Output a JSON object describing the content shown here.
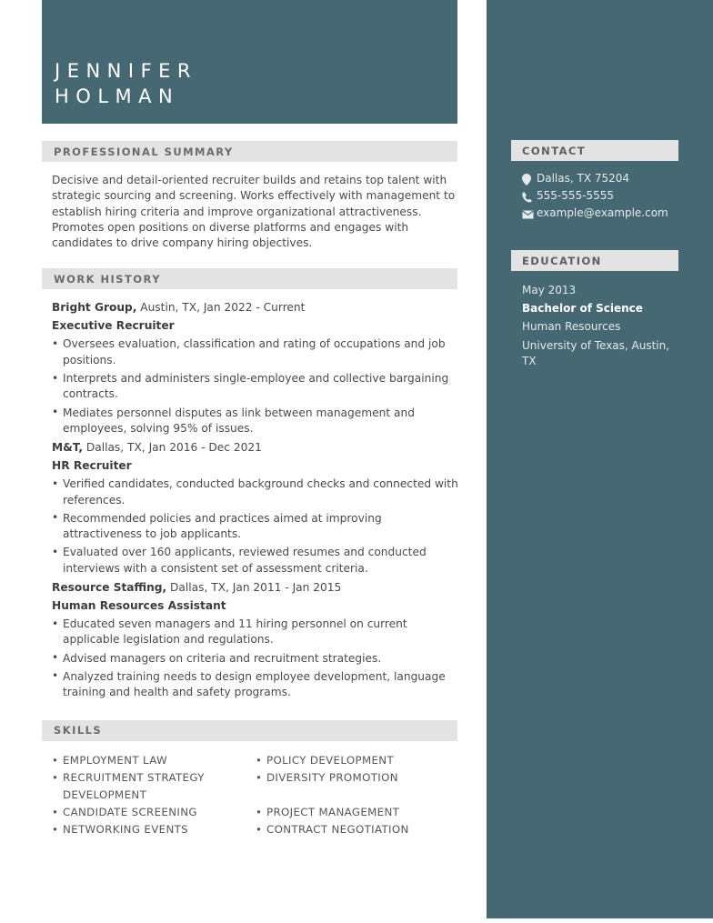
{
  "theme": {
    "accent": "#456872",
    "section_bar": "#e3e3e3",
    "body_text": "#4a4a4a",
    "sidebar_text": "#e6eaeb"
  },
  "header": {
    "first_name": "JENNIFER",
    "last_name": "HOLMAN"
  },
  "sections": {
    "summary_heading": "PROFESSIONAL SUMMARY",
    "work_heading": "WORK HISTORY",
    "skills_heading": "SKILLS",
    "contact_heading": "CONTACT",
    "education_heading": "EDUCATION"
  },
  "summary": {
    "text": "Decisive and detail-oriented recruiter builds and retains top talent with strategic sourcing and screening. Works effectively with management to establish hiring criteria and improve organizational attractiveness. Promotes open positions on diverse platforms and engages with candidates to drive company hiring objectives."
  },
  "work_history": [
    {
      "company": "Bright Group,",
      "meta": " Austin, TX, Jan 2022 - Current",
      "title": "Executive Recruiter",
      "bullets": [
        "Oversees evaluation, classification and rating of occupations and job positions.",
        "Interprets and administers single-employee and collective bargaining contracts.",
        "Mediates personnel disputes as link between management and employees, solving 95% of issues."
      ]
    },
    {
      "company": "M&T,",
      "meta": " Dallas, TX, Jan 2016 - Dec 2021",
      "title": "HR Recruiter",
      "bullets": [
        "Verified candidates, conducted background checks and connected with references.",
        "Recommended policies and practices aimed at improving attractiveness to job applicants.",
        "Evaluated over 160 applicants, reviewed resumes and conducted interviews with a consistent set of assessment criteria."
      ]
    },
    {
      "company": "Resource Staffing,",
      "meta": " Dallas, TX, Jan 2011 - Jan 2015",
      "title": "Human Resources Assistant",
      "bullets": [
        "Educated seven managers and 11 hiring personnel on current applicable legislation and regulations.",
        "Advised managers on criteria and recruitment strategies.",
        "Analyzed training needs to design employee development, language training and health and safety programs."
      ]
    }
  ],
  "skills": {
    "left_column": [
      "EMPLOYMENT LAW",
      "RECRUITMENT STRATEGY DEVELOPMENT",
      "CANDIDATE SCREENING",
      "NETWORKING EVENTS"
    ],
    "right_column": [
      "POLICY DEVELOPMENT",
      "DIVERSITY PROMOTION",
      "PROJECT MANAGEMENT",
      "CONTRACT NEGOTIATION"
    ]
  },
  "contact": {
    "items": [
      {
        "icon": "location-pin-icon",
        "text": "Dallas, TX 75204"
      },
      {
        "icon": "phone-icon",
        "text": "555-555-5555"
      },
      {
        "icon": "envelope-icon",
        "text": "example@example.com"
      }
    ]
  },
  "education": {
    "date": "May 2013",
    "degree": "Bachelor of Science",
    "field": "Human Resources",
    "school": "University of Texas, Austin, TX"
  }
}
